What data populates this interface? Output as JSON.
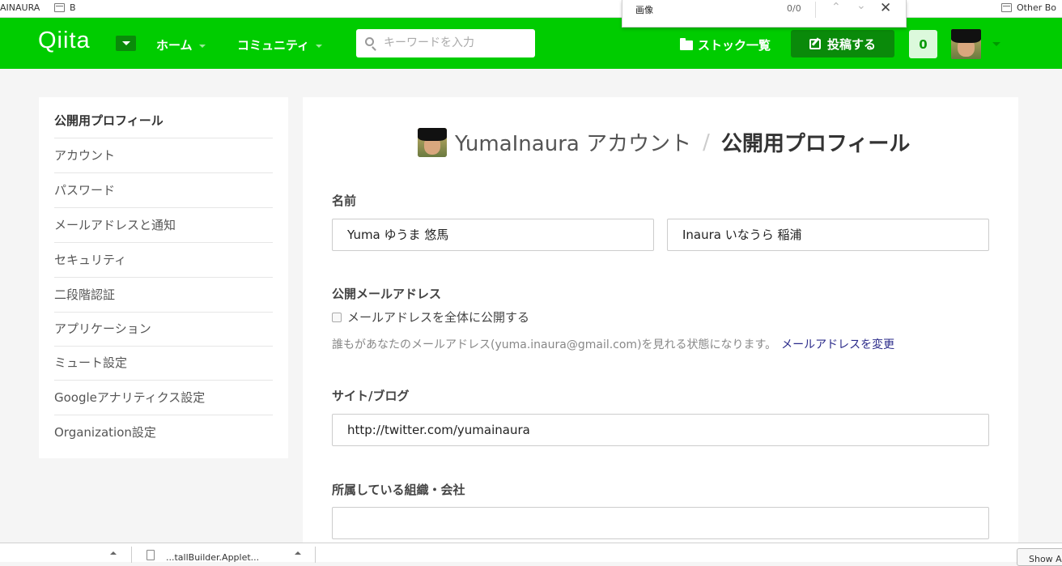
{
  "browser": {
    "bookmarks": [
      {
        "label": "AINAURA"
      },
      {
        "label": "B"
      },
      {
        "label": "Other Bo"
      }
    ],
    "find": {
      "query": "画像",
      "count": "0/0"
    },
    "downloads": {
      "item": "...tallBuilder.Applet...",
      "show_all": "Show A"
    }
  },
  "header": {
    "logo": "Qiita",
    "nav": {
      "home": "ホーム",
      "community": "コミュニティ"
    },
    "search_placeholder": "キーワードを入力",
    "stock": "ストック一覧",
    "post": "投稿する",
    "notifications": "0"
  },
  "sidebar": {
    "items": [
      {
        "label": "公開用プロフィール"
      },
      {
        "label": "アカウント"
      },
      {
        "label": "パスワード"
      },
      {
        "label": "メールアドレスと通知"
      },
      {
        "label": "セキュリティ"
      },
      {
        "label": "二段階認証"
      },
      {
        "label": "アプリケーション"
      },
      {
        "label": "ミュート設定"
      },
      {
        "label": "Googleアナリティクス設定"
      },
      {
        "label": "Organization設定"
      }
    ]
  },
  "main": {
    "title": {
      "user": "YumaInaura アカウント",
      "section": "公開用プロフィール"
    },
    "name": {
      "label": "名前",
      "first": "Yuma ゆうま 悠馬",
      "last": "Inaura いなうら 稲浦"
    },
    "email": {
      "label": "公開メールアドレス",
      "checkbox": "メールアドレスを全体に公開する",
      "help": "誰もがあなたのメールアドレス(yuma.inaura@gmail.com)を見れる状態になります。",
      "change_link": "メールアドレスを変更"
    },
    "site": {
      "label": "サイト/ブログ",
      "value": "http://twitter.com/yumainaura"
    },
    "org": {
      "label": "所属している組織・会社",
      "value": ""
    }
  },
  "colors": {
    "brand": "#00cc00",
    "brand_dark": "#0a8a0a"
  }
}
